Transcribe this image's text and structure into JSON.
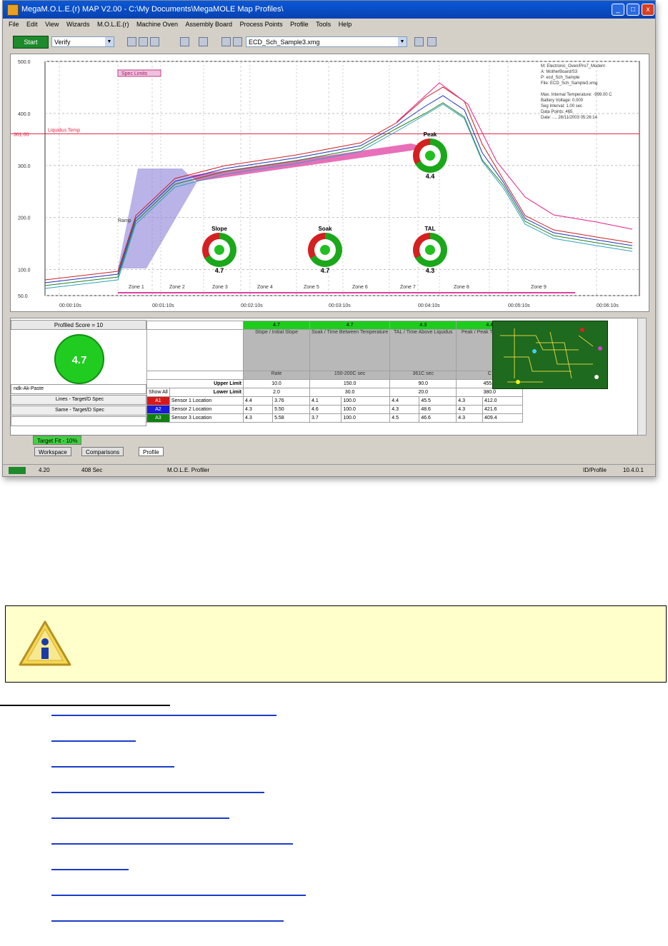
{
  "window": {
    "title": "MegaM.O.L.E.(r) MAP V2.00 - C:\\My Documents\\MegaMOLE Map Profiles\\",
    "buttons": {
      "minimize": "_",
      "maximize": "□",
      "close": "x"
    }
  },
  "menu": [
    "File",
    "Edit",
    "View",
    "Wizards",
    "M.O.L.E.(r)",
    "Machine Oven",
    "Assembly Board",
    "Process Points",
    "Profile",
    "Tools",
    "Help"
  ],
  "toolbar": {
    "start_label": "Start",
    "view_combo": "Verify",
    "file_combo": "ECD_Sch_Sample3.xmg"
  },
  "plot": {
    "y_ticks": [
      "500.0",
      "400.0",
      "300.0",
      "200.0",
      "100.0",
      "50.0"
    ],
    "y_marker": "361.00",
    "spec_line_label": "Liquidus Temp",
    "legend_box": "Spec Limits",
    "x_ticks": [
      "00:00:10s",
      "00:01:10s",
      "00:02:10s",
      "00:03:10s",
      "00:04:10s",
      "00:05:10s",
      "00:06:10s"
    ],
    "zones": [
      "Zone 1",
      "Zone 2",
      "Zone 3",
      "Zone 4",
      "Zone 5",
      "Zone 6",
      "Zone 7",
      "Zone 8",
      "Zone 9"
    ],
    "info_lines": [
      "M: Electronic_Oven/Pro7_Modern",
      "A: MotherBoard/S3",
      "P: ecd_Sch_Sample",
      "File: ECD_Sch_Sample3.xmg",
      "",
      "Max. Internal Temperature: -999.00 C",
      "Battery Voltage: 0.000",
      "Seg Interval: 1.00 sec",
      "Data Points: 465",
      "Date: .... 28/11/2003 05:26:14"
    ],
    "ramp_label": "Ramp",
    "series_colors": {
      "peak_band": "#e0208a",
      "ramp_band": "#7a6acf",
      "t1": "#d02020",
      "t2": "#2030c0",
      "t3": "#208020",
      "t4": "#30a0c0"
    }
  },
  "gauges": [
    {
      "label": "Slope",
      "value": "4.7"
    },
    {
      "label": "Soak",
      "value": "4.7"
    },
    {
      "label": "TAL",
      "value": "4.3"
    },
    {
      "label": "Peak",
      "value": "4.4"
    }
  ],
  "stats": {
    "score_header": "Profiled Score = 10",
    "score_value": "4.7",
    "left_rows": [
      "ndk-Ak-Paste",
      "Lines - Target/D Spec",
      "Same - Target/D Spec",
      ""
    ],
    "group_heads": [
      "4.7",
      "4.7",
      "4.3",
      "4.4"
    ],
    "group_desc": [
      "Slope / Initial Slope",
      "Soak / Time Between Temperature",
      "TAL / Time Above Liquidus",
      "Peak / Peak Temperature"
    ],
    "group_units": [
      "Rate",
      "150-200C sec",
      "361C sec",
      "C"
    ],
    "upper_label": "Upper Limit",
    "lower_label": "Lower Limit",
    "show_all": "Show All",
    "upper_vals": [
      "10.0",
      "150.0",
      "90.0",
      "455.0"
    ],
    "lower_vals": [
      "2.0",
      "30.0",
      "20.0",
      "380.0"
    ],
    "rows": [
      {
        "tag": "A1",
        "color": "#d81818",
        "name": "Sensor 1 Location",
        "cells": [
          "4.4",
          "3.76",
          "4.1",
          "100.0",
          "4.4",
          "45.5",
          "4.3",
          "412.0"
        ]
      },
      {
        "tag": "A2",
        "color": "#1a1ad8",
        "name": "Sensor 2 Location",
        "cells": [
          "4.3",
          "5.50",
          "4.6",
          "100.0",
          "4.3",
          "48.6",
          "4.3",
          "421.6"
        ]
      },
      {
        "tag": "A3",
        "color": "#108010",
        "name": "Sensor 3 Location",
        "cells": [
          "4.3",
          "5.58",
          "3.7",
          "100.0",
          "4.5",
          "46.6",
          "4.3",
          "409.4"
        ]
      }
    ]
  },
  "tabs": {
    "sheet_tab": "Target Fit - 10%",
    "bottom_tabs": [
      "Workspace",
      "Comparisons",
      "Profile"
    ]
  },
  "status": {
    "items": [
      "4.20",
      "408 Sec",
      "M.O.L.E. Profiler"
    ],
    "right": [
      "ID/Profile",
      "10.4.0.1"
    ]
  },
  "note": {
    "icon": "info-icon"
  },
  "links": [
    {
      "w": 315
    },
    {
      "w": 118
    },
    {
      "w": 172
    },
    {
      "w": 298
    },
    {
      "w": 249
    },
    {
      "w": 338
    },
    {
      "w": 108
    },
    {
      "w": 356
    },
    {
      "w": 325
    }
  ]
}
